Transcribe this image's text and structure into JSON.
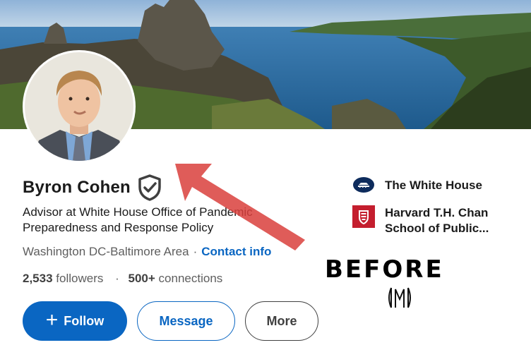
{
  "profile": {
    "name": "Byron Cohen",
    "headline": "Advisor at White House Office of Pandemic Preparedness and Response Policy",
    "location": "Washington DC-Baltimore Area",
    "location_separator": "·",
    "contact_label": "Contact info",
    "followers_count": "2,533",
    "followers_label": "followers",
    "stats_separator": "·",
    "connections_count": "500+",
    "connections_label": "connections",
    "verified_icon": "shield-check-icon"
  },
  "actions": {
    "follow_icon": "+",
    "follow_label": "Follow",
    "message_label": "Message",
    "more_label": "More"
  },
  "organizations": [
    {
      "name": "The White House",
      "logo": "white-house-logo"
    },
    {
      "name": "Harvard T.H. Chan School of Public...",
      "logo": "harvard-shield-logo"
    }
  ],
  "overlay": {
    "caption": "BEFORE",
    "arrow_color": "#d9403c"
  },
  "colors": {
    "brand_blue": "#0a66c2",
    "text_primary": "#1b1b1b",
    "text_secondary": "#5e5e5e",
    "harvard_red": "#c41e2e"
  }
}
